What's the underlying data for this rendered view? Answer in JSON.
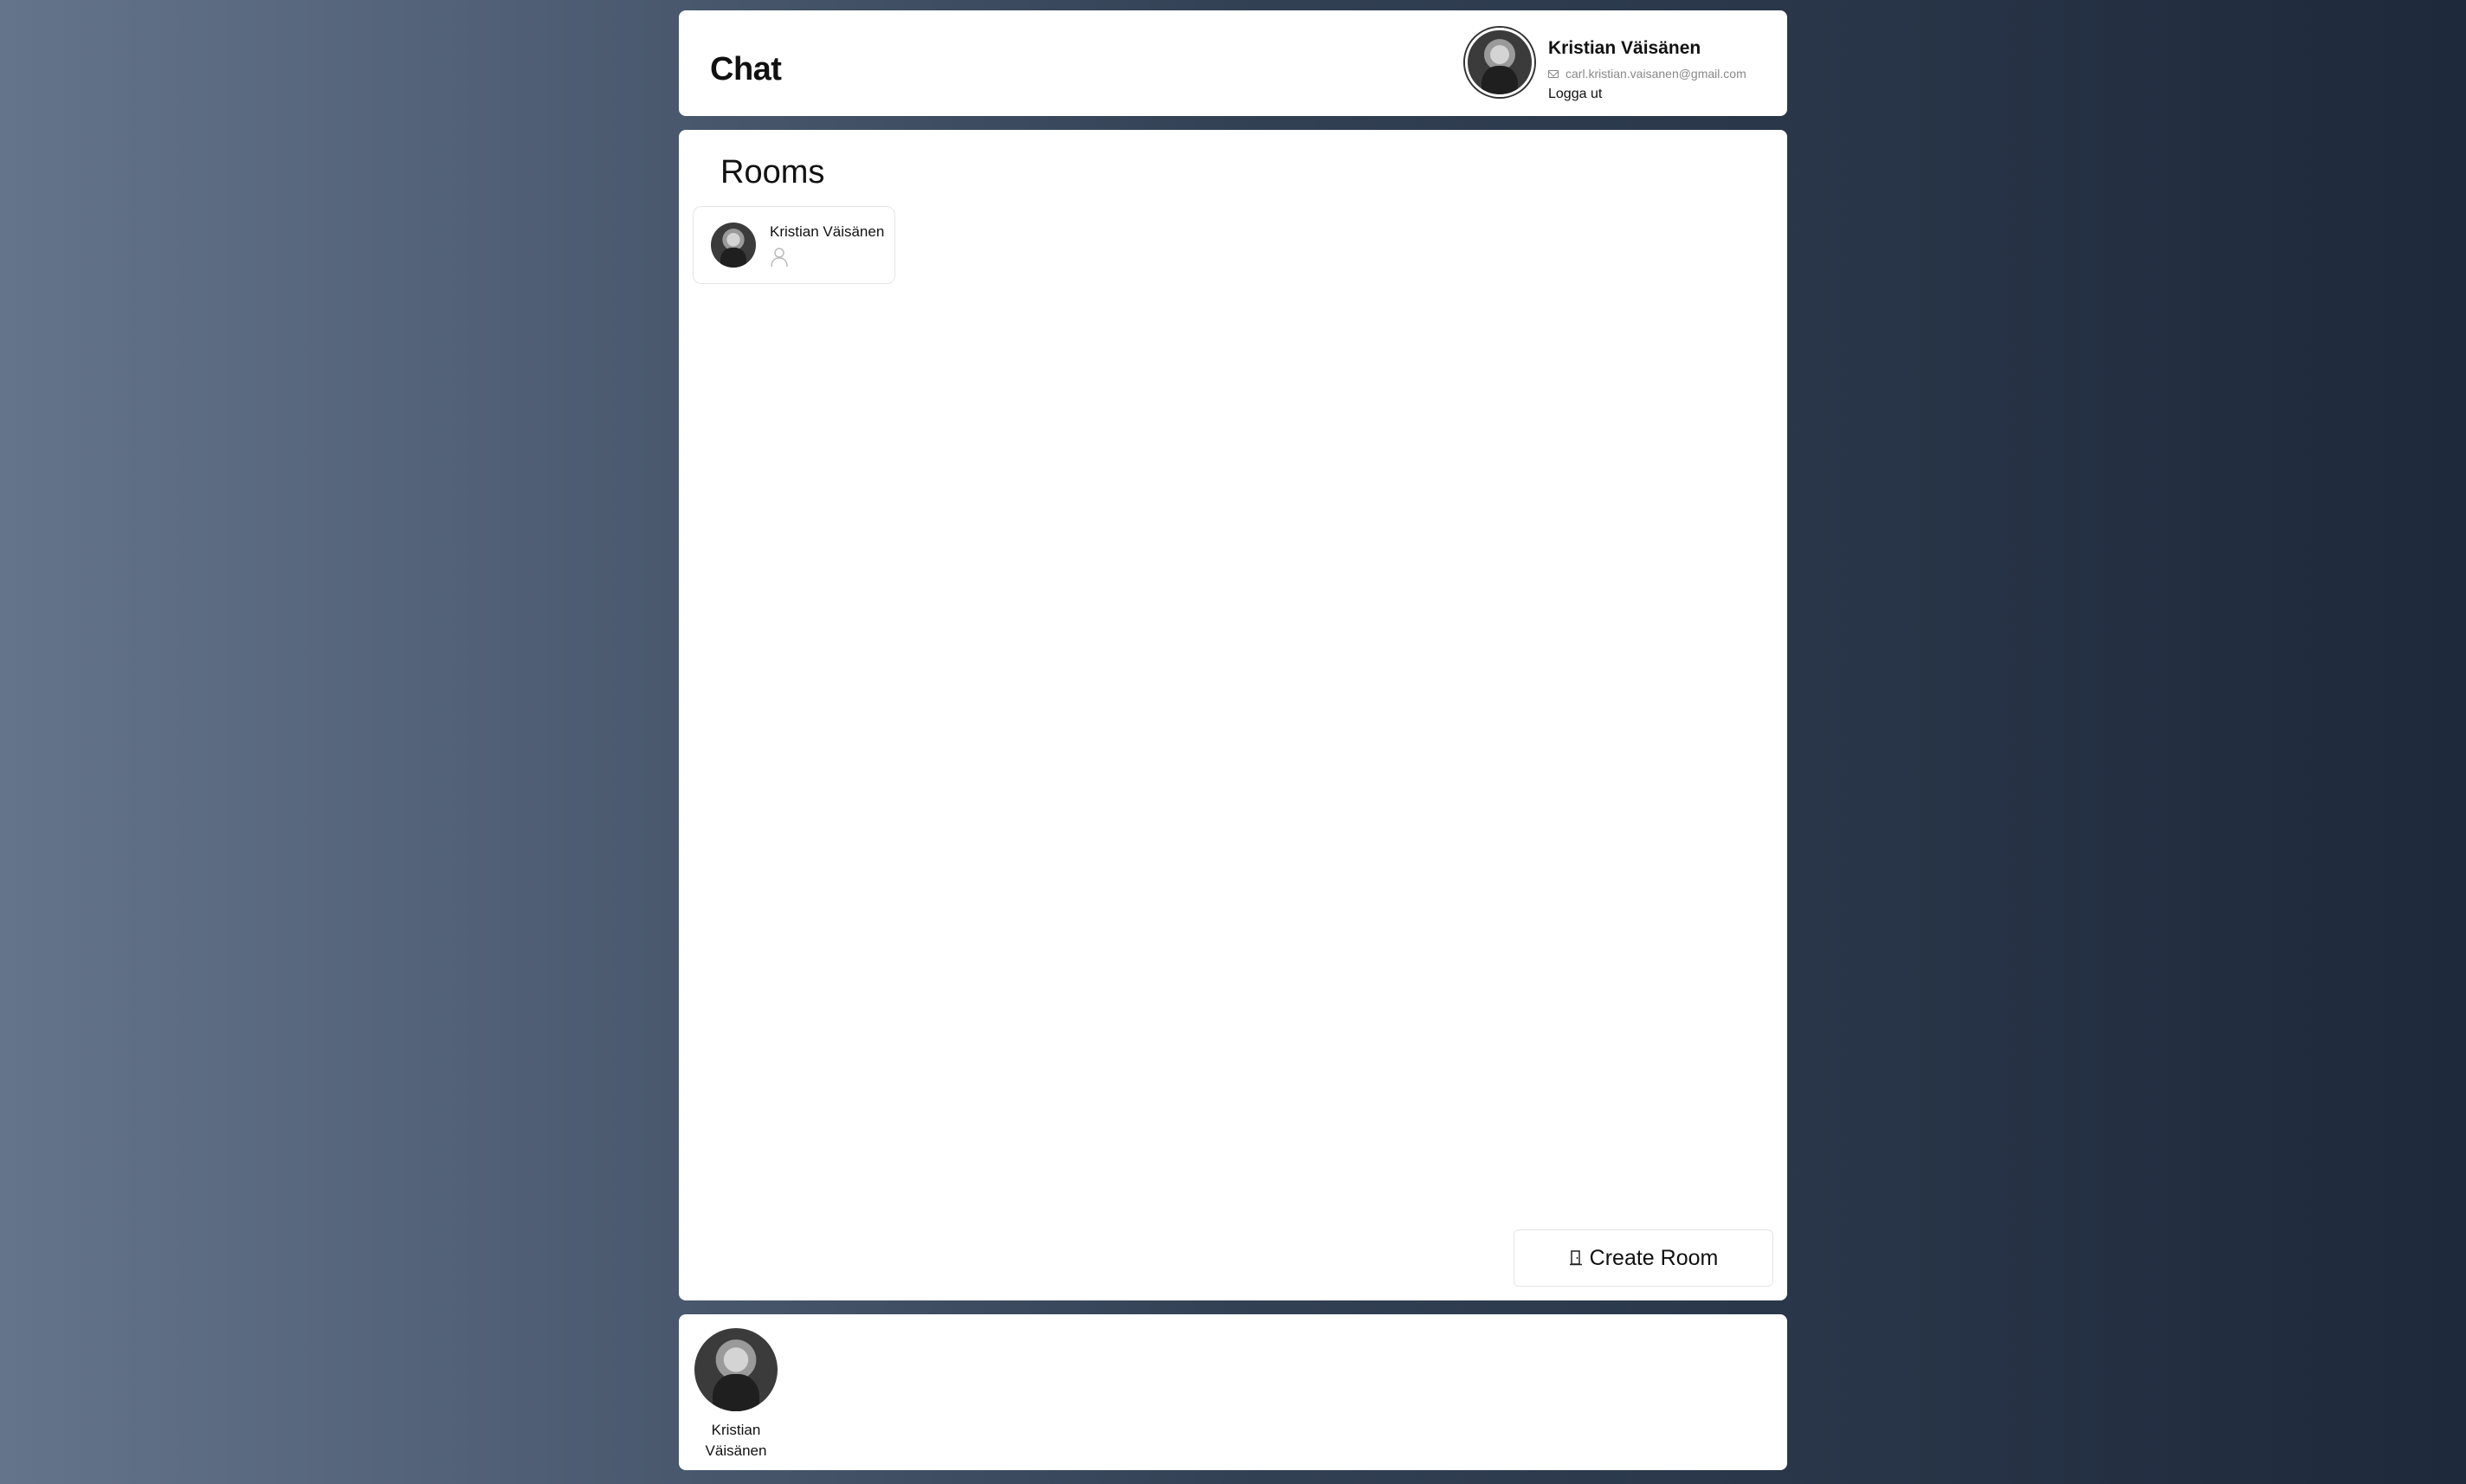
{
  "header": {
    "title": "Chat",
    "user": {
      "name": "Kristian Väisänen",
      "email": "carl.kristian.vaisanen@gmail.com",
      "logout_label": "Logga ut"
    }
  },
  "main": {
    "rooms_title": "Rooms",
    "rooms": [
      {
        "name": "Kristian Väisänen",
        "member_icon": "person-icon"
      }
    ],
    "create_room_label": "Create Room",
    "create_room_icon": "door-icon"
  },
  "footer": {
    "online_users": [
      {
        "name": "Kristian Väisänen"
      }
    ]
  }
}
